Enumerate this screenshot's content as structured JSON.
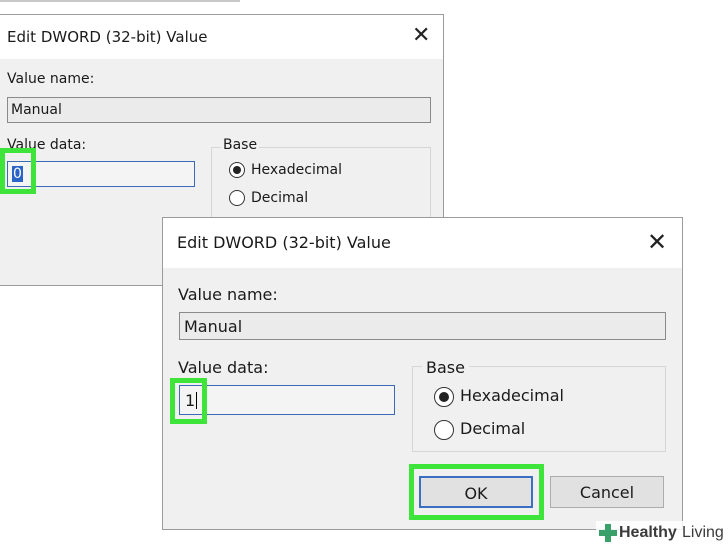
{
  "back_dialog": {
    "title": "Edit DWORD (32-bit) Value",
    "value_name_label": "Value name:",
    "value_name": "Manual",
    "value_data_label": "Value data:",
    "value_data": "0",
    "base_label": "Base",
    "radio_hex": "Hexadecimal",
    "radio_dec": "Decimal",
    "selected_base": "Hexadecimal"
  },
  "front_dialog": {
    "title": "Edit DWORD (32-bit) Value",
    "value_name_label": "Value name:",
    "value_name": "Manual",
    "value_data_label": "Value data:",
    "value_data": "1",
    "base_label": "Base",
    "radio_hex": "Hexadecimal",
    "radio_dec": "Decimal",
    "selected_base": "Hexadecimal",
    "ok_label": "OK",
    "cancel_label": "Cancel"
  },
  "watermark": {
    "brand_bold": "Healthy",
    "brand_light": "Living"
  },
  "colors": {
    "highlight": "#3fe43b",
    "dialog_bg": "#f0f0f0",
    "selection": "#2b63c6",
    "brand": "#3aa06a"
  }
}
